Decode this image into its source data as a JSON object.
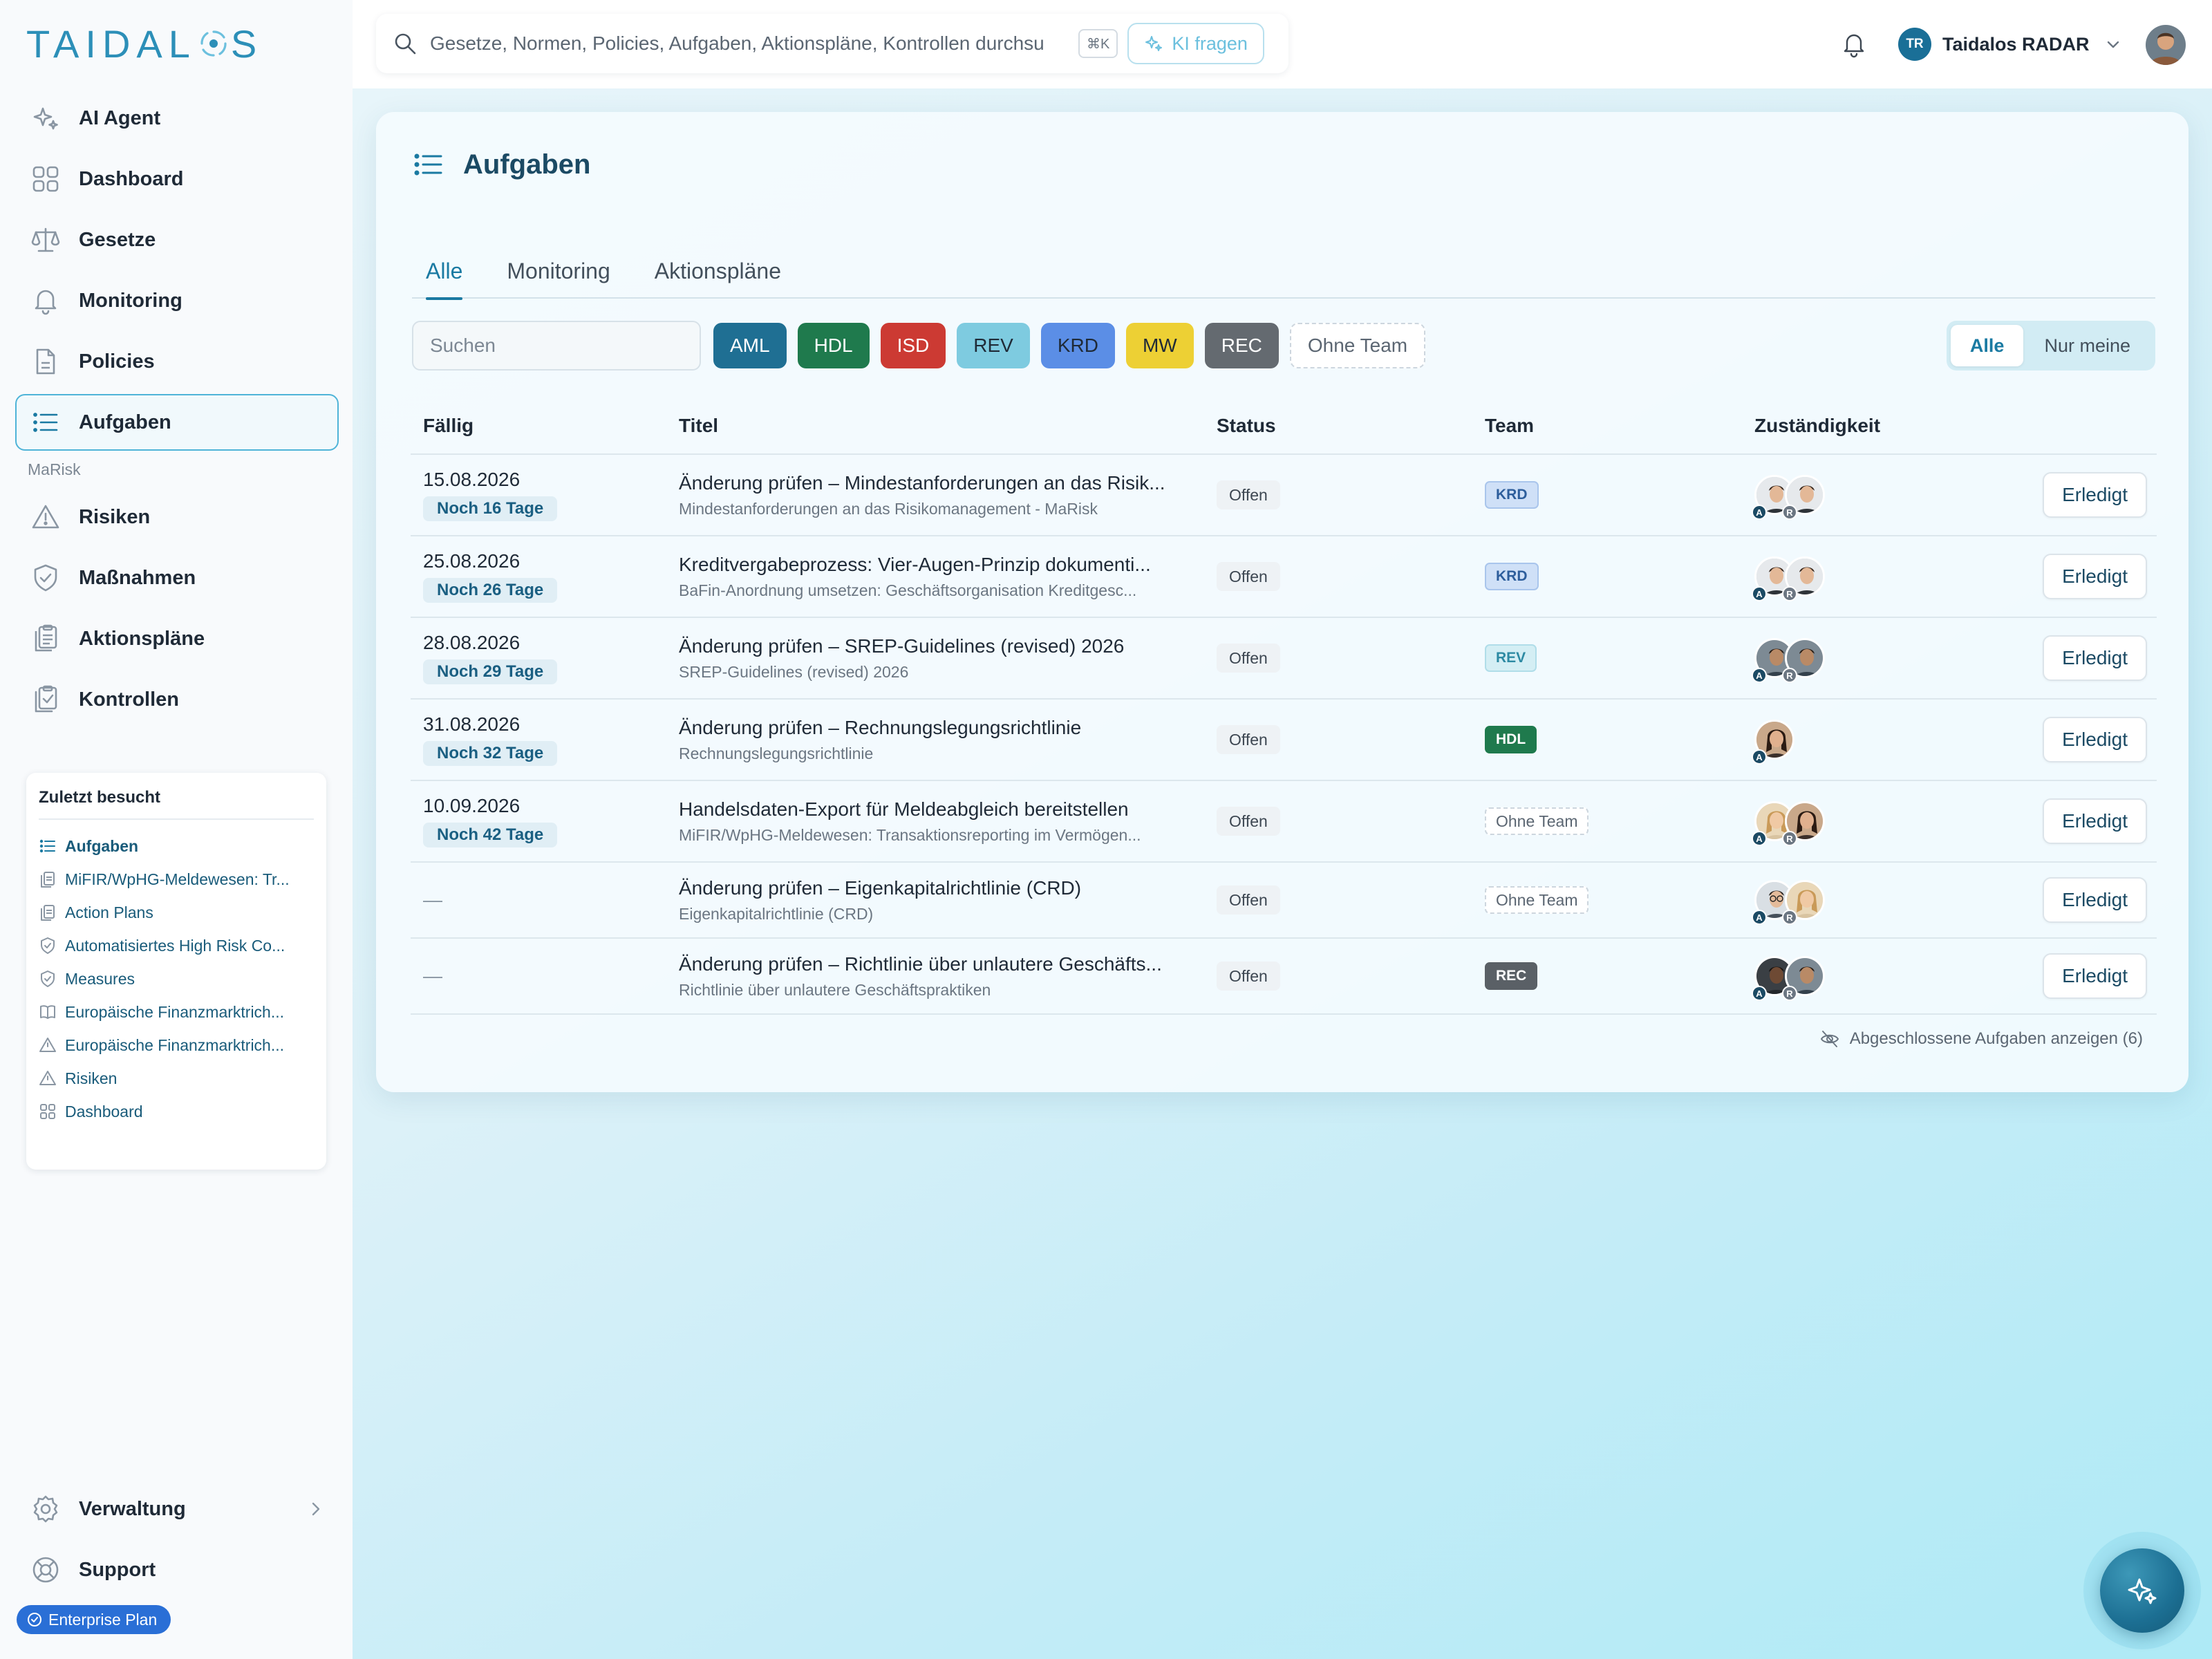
{
  "brand": {
    "name_left": "TAIDAL",
    "name_right": "S",
    "color": "#2c8fb8"
  },
  "search": {
    "placeholder": "Gesetze, Normen, Policies, Aufgaben, Aktionspläne, Kontrollen durchsu",
    "shortcut": "⌘K",
    "ai_button": "KI fragen"
  },
  "header": {
    "org_initials": "TR",
    "org_name": "Taidalos RADAR"
  },
  "sidebar": {
    "items": [
      {
        "label": "AI Agent",
        "icon": "sparkles-icon"
      },
      {
        "label": "Dashboard",
        "icon": "grid-icon"
      },
      {
        "label": "Gesetze",
        "icon": "scale-icon"
      },
      {
        "label": "Monitoring",
        "icon": "bell-icon"
      },
      {
        "label": "Policies",
        "icon": "document-icon"
      },
      {
        "label": "Aufgaben",
        "icon": "list-icon",
        "active": true
      }
    ],
    "section_label": "MaRisk",
    "section_items": [
      {
        "label": "Risiken",
        "icon": "warning-icon"
      },
      {
        "label": "Maßnahmen",
        "icon": "shield-check-icon"
      },
      {
        "label": "Aktionspläne",
        "icon": "clipboard-icon"
      },
      {
        "label": "Kontrollen",
        "icon": "clipboard-check-icon"
      }
    ],
    "recent": {
      "title": "Zuletzt besucht",
      "items": [
        {
          "label": "Aufgaben",
          "icon": "list-icon"
        },
        {
          "label": "MiFIR/WpHG-Meldewesen: Tr...",
          "icon": "clipboard-icon"
        },
        {
          "label": "Action Plans",
          "icon": "clipboard-icon"
        },
        {
          "label": "Automatisiertes High Risk Co...",
          "icon": "shield-check-icon"
        },
        {
          "label": "Measures",
          "icon": "shield-check-icon"
        },
        {
          "label": "Europäische Finanzmarktrich...",
          "icon": "book-icon"
        },
        {
          "label": "Europäische Finanzmarktrich...",
          "icon": "warning-icon"
        },
        {
          "label": "Risiken",
          "icon": "warning-icon"
        },
        {
          "label": "Dashboard",
          "icon": "grid-icon"
        }
      ]
    },
    "bottom": [
      {
        "label": "Verwaltung",
        "icon": "gear-icon"
      },
      {
        "label": "Support",
        "icon": "lifebuoy-icon"
      }
    ],
    "plan": "Enterprise Plan"
  },
  "page": {
    "title": "Aufgaben",
    "tabs": [
      "Alle",
      "Monitoring",
      "Aktionspläne"
    ],
    "active_tab": 0,
    "filter_placeholder": "Suchen",
    "team_chips": [
      {
        "label": "AML",
        "bg": "#1f6f93",
        "fg": "#ffffff"
      },
      {
        "label": "HDL",
        "bg": "#1f7a4d",
        "fg": "#ffffff"
      },
      {
        "label": "ISD",
        "bg": "#cc3a33",
        "fg": "#ffffff"
      },
      {
        "label": "REV",
        "bg": "#7ecbe0",
        "fg": "#1f2a37"
      },
      {
        "label": "KRD",
        "bg": "#5b8ee6",
        "fg": "#1f2a37"
      },
      {
        "label": "MW",
        "bg": "#edd034",
        "fg": "#1f2a37"
      },
      {
        "label": "REC",
        "bg": "#646a70",
        "fg": "#ffffff"
      }
    ],
    "no_team_chip": "Ohne Team",
    "scope_toggle": [
      "Alle",
      "Nur meine"
    ],
    "scope_active": 0,
    "columns": {
      "due": "Fällig",
      "title": "Titel",
      "status": "Status",
      "team": "Team",
      "owner": "Zuständigkeit"
    },
    "rows": [
      {
        "due": "15.08.2026",
        "remaining": "Noch 16 Tage",
        "title": "Änderung prüfen – Mindestanforderungen an das Risik...",
        "subtitle": "Mindestanforderungen an das Risikomanagement - MaRisk",
        "status": "Offen",
        "team": "KRD",
        "team_style": "krd",
        "avatars": [
          "male-suit",
          "male-suit"
        ],
        "action": "Erledigt"
      },
      {
        "due": "25.08.2026",
        "remaining": "Noch 26 Tage",
        "title": "Kreditvergabeprozess: Vier-Augen-Prinzip dokumenti...",
        "subtitle": "BaFin-Anordnung umsetzen: Geschäftsorganisation Kreditgesc...",
        "status": "Offen",
        "team": "KRD",
        "team_style": "krd",
        "avatars": [
          "male-suit",
          "male-suit"
        ],
        "action": "Erledigt"
      },
      {
        "due": "28.08.2026",
        "remaining": "Noch 29 Tage",
        "title": "Änderung prüfen – SREP-Guidelines (revised) 2026",
        "subtitle": "SREP-Guidelines (revised) 2026",
        "status": "Offen",
        "team": "REV",
        "team_style": "rev",
        "avatars": [
          "male-dark",
          "male-dark"
        ],
        "action": "Erledigt"
      },
      {
        "due": "31.08.2026",
        "remaining": "Noch 32 Tage",
        "title": "Änderung prüfen – Rechnungslegungsrichtlinie",
        "subtitle": "Rechnungslegungsrichtlinie",
        "status": "Offen",
        "team": "HDL",
        "team_style": "hdl",
        "avatars": [
          "female-dark"
        ],
        "action": "Erledigt"
      },
      {
        "due": "10.09.2026",
        "remaining": "Noch 42 Tage",
        "title": "Handelsdaten-Export für Meldeabgleich bereitstellen",
        "subtitle": "MiFIR/WpHG-Meldewesen: Transaktionsreporting im Vermögen...",
        "status": "Offen",
        "team": "Ohne Team",
        "team_style": "none",
        "avatars": [
          "female-light",
          "female-dark"
        ],
        "action": "Erledigt"
      },
      {
        "due": "—",
        "remaining": "",
        "title": "Änderung prüfen – Eigenkapitalrichtlinie (CRD)",
        "subtitle": "Eigenkapitalrichtlinie (CRD)",
        "status": "Offen",
        "team": "Ohne Team",
        "team_style": "none",
        "avatars": [
          "male-glasses",
          "female-light"
        ],
        "action": "Erledigt"
      },
      {
        "due": "—",
        "remaining": "",
        "title": "Änderung prüfen – Richtlinie über unlautere Geschäfts...",
        "subtitle": "Richtlinie über unlautere Geschäftspraktiken",
        "status": "Offen",
        "team": "REC",
        "team_style": "rec",
        "avatars": [
          "male-black",
          "male-dark"
        ],
        "action": "Erledigt"
      }
    ],
    "avatar_tags": {
      "a": "A",
      "r": "R"
    },
    "show_closed": "Abgeschlossene Aufgaben anzeigen (6)"
  }
}
